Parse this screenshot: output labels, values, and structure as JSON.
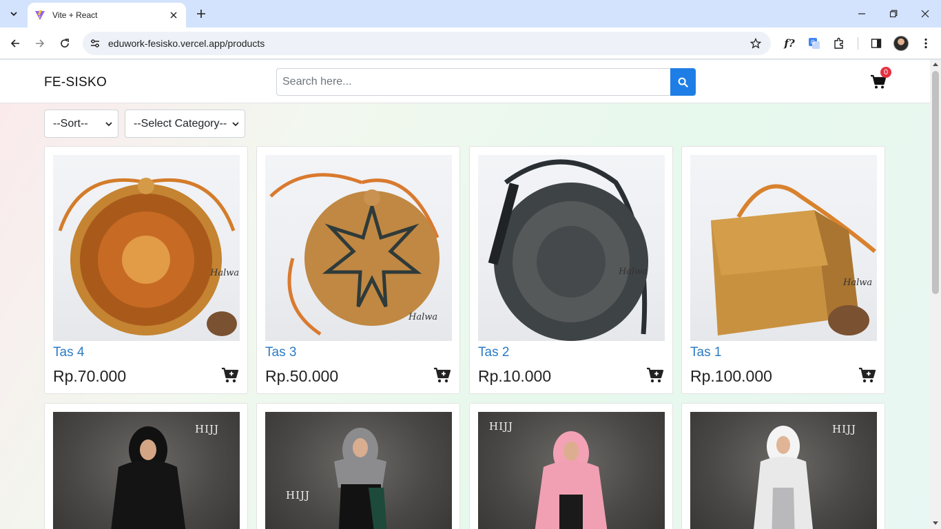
{
  "browser": {
    "tab_title": "Vite + React",
    "url": "eduwork-fesisko.vercel.app/products"
  },
  "navbar": {
    "brand": "FE-SISKO",
    "search_placeholder": "Search here...",
    "cart_count": "0"
  },
  "filters": {
    "sort_selected": "--Sort--",
    "category_selected": "--Select Category--"
  },
  "products": [
    {
      "name": "Tas 4",
      "price": "Rp.70.000",
      "watermark": "Halwa"
    },
    {
      "name": "Tas 3",
      "price": "Rp.50.000",
      "watermark": "Halwa"
    },
    {
      "name": "Tas 2",
      "price": "Rp.10.000",
      "watermark": "Halwa"
    },
    {
      "name": "Tas 1",
      "price": "Rp.100.000",
      "watermark": "Halwa"
    }
  ],
  "products_row2_watermark": "HIJJ",
  "colors": {
    "accent": "#1e7ee6",
    "product_name": "#2b7bc4",
    "badge": "#e53141"
  }
}
